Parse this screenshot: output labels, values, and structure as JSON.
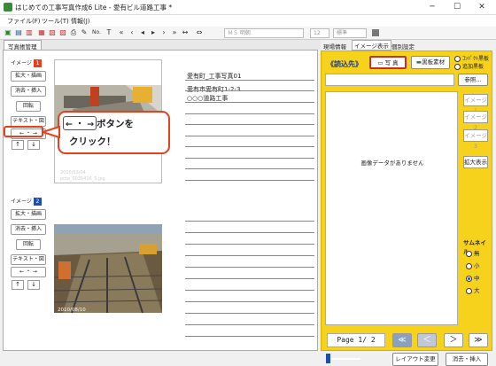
{
  "titlebar": {
    "title": "はじめての工事写真作成6 Lite - 愛有ビル道路工事  *",
    "minimize": "─",
    "maximize": "☐",
    "close": "✕"
  },
  "menu": {
    "file": "ファイル(F)",
    "tool": "ツール(T)",
    "info": "情報(J)"
  },
  "toolbar": {
    "font_name": "ＭＳ 明朝",
    "font_size": "12",
    "style": "標準",
    "number_label": "No."
  },
  "tabs": {
    "photo_ledger": "写真帳管理"
  },
  "sidebar": {
    "image1_label": "イメージ",
    "image1_num": "1",
    "image2_label": "イメージ",
    "image2_num": "2",
    "zoom_rotate": "拡大・描画",
    "delete_insert": "消去・挿入",
    "rotate": "回転",
    "text_shape": "テキスト・図",
    "swap": "← ・ →",
    "up": "↑",
    "down": "↓"
  },
  "photo1": {
    "date": "2010/03/04",
    "filename": "pcta_0035416_S.jpg"
  },
  "photo2": {
    "date": "2010/08/10"
  },
  "entry1": {
    "line1": "愛有町_工事写真01",
    "line2": "愛有市愛有町1-2-3",
    "line3": "○○○道路工事"
  },
  "callout": {
    "buttons": "← ・ →",
    "suffix": "ボタンを",
    "line2": "クリック！"
  },
  "right_tabs": {
    "site_info": "現場情報",
    "image_display": "イメージ表示",
    "individual": "個別設定"
  },
  "right": {
    "load_from": "《読込先》",
    "photo_btn": "写 真",
    "blackboard_btn": "黒板素材",
    "blackboard_opt1": "ｺﾝﾊﾟｸﾄ黒板",
    "blackboard_opt2": "追加黒板",
    "reference": "参照...",
    "no_image": "画像データがありません",
    "image1": "イメージ1",
    "image2": "イメージ2",
    "image3": "イメージ3",
    "zoom_display": "拡大表示",
    "thumbnail": "サムネイル",
    "thumb_none": "無",
    "thumb_small": "小",
    "thumb_medium": "中",
    "thumb_large": "大",
    "page": "Page  1/ 2",
    "layout_change": "レイアウト変更",
    "delete_insert": "消去・挿入",
    "nav_first": "≪",
    "nav_prev": "＜",
    "nav_next": "＞",
    "nav_last": "≫"
  },
  "colors": {
    "accent_red": "#e8401a",
    "panel_yellow": "#f7d21c",
    "image_blue": "#1a4fb0"
  }
}
